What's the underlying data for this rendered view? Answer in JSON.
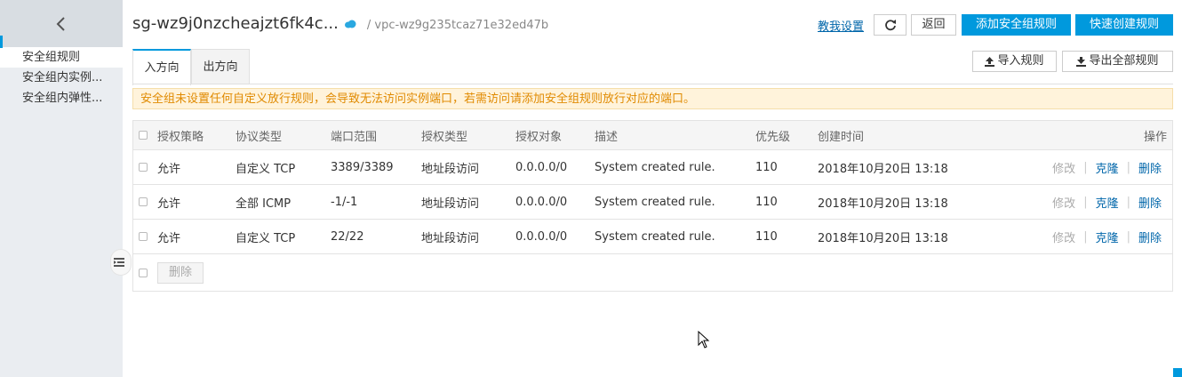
{
  "sidebar": {
    "back_icon": "chevron-left-icon",
    "items": [
      {
        "label": "安全组规则"
      },
      {
        "label": "安全组内实例..."
      },
      {
        "label": "安全组内弹性..."
      }
    ]
  },
  "header": {
    "title": "sg-wz9j0nzcheajzt6fk4c...",
    "breadcrumb": "/ vpc-wz9g235tcaz71e32ed47b",
    "help_link": "教我设置",
    "refresh_icon": "refresh-icon",
    "back_label": "返回",
    "add_rule_label": "添加安全组规则",
    "quick_create_label": "快速创建规则"
  },
  "tabs": [
    {
      "label": "入方向"
    },
    {
      "label": "出方向"
    }
  ],
  "toolbar": {
    "import_label": "导入规则",
    "export_label": "导出全部规则"
  },
  "notice": "安全组未设置任何自定义放行规则，会导致无法访问实例端口，若需访问请添加安全组规则放行对应的端口。",
  "table": {
    "columns": [
      "授权策略",
      "协议类型",
      "端口范围",
      "授权类型",
      "授权对象",
      "描述",
      "优先级",
      "创建时间",
      "操作"
    ],
    "rows": [
      {
        "policy": "允许",
        "protocol": "自定义 TCP",
        "port": "3389/3389",
        "auth_type": "地址段访问",
        "auth_object": "0.0.0.0/0",
        "desc": "System created rule.",
        "priority": "110",
        "created": "2018年10月20日 13:18",
        "edit": "修改",
        "clone": "克隆",
        "delete": "删除"
      },
      {
        "policy": "允许",
        "protocol": "全部 ICMP",
        "port": "-1/-1",
        "auth_type": "地址段访问",
        "auth_object": "0.0.0.0/0",
        "desc": "System created rule.",
        "priority": "110",
        "created": "2018年10月20日 13:18",
        "edit": "修改",
        "clone": "克隆",
        "delete": "删除"
      },
      {
        "policy": "允许",
        "protocol": "自定义 TCP",
        "port": "22/22",
        "auth_type": "地址段访问",
        "auth_object": "0.0.0.0/0",
        "desc": "System created rule.",
        "priority": "110",
        "created": "2018年10月20日 13:18",
        "edit": "修改",
        "clone": "克隆",
        "delete": "删除"
      }
    ],
    "bulk_delete_label": "删除"
  },
  "colors": {
    "accent": "#0099dd",
    "link": "#0066aa",
    "warning_text": "#e08a00",
    "warning_bg": "#fff3db"
  }
}
